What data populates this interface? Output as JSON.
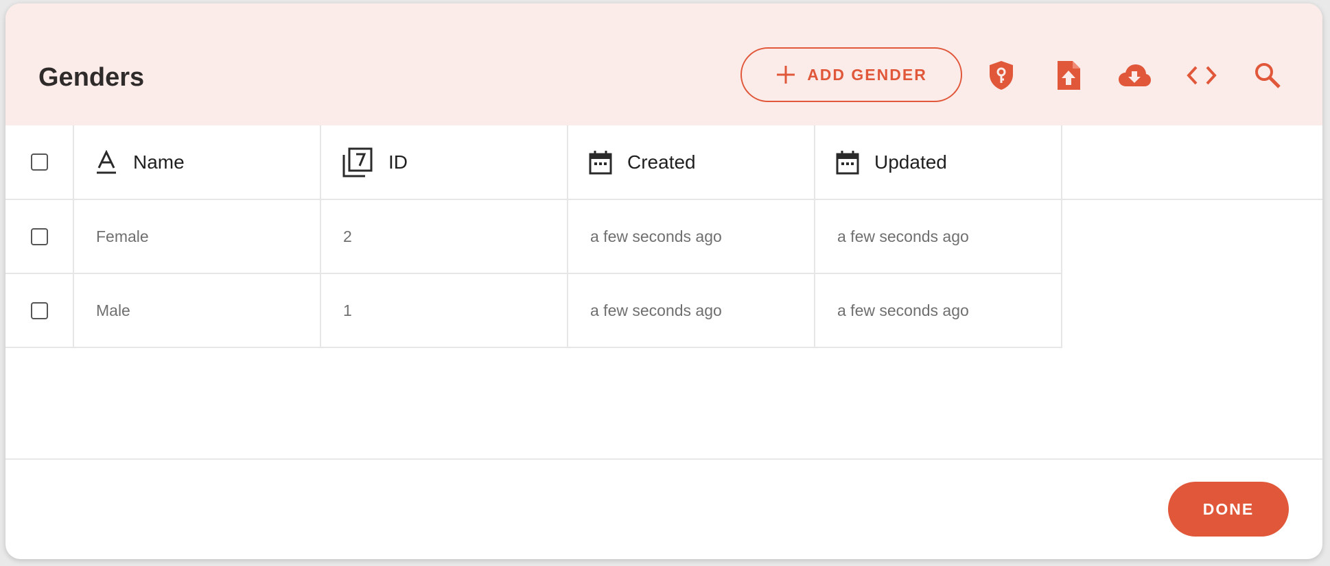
{
  "dialog": {
    "title": "Genders",
    "add_button_label": "ADD GENDER",
    "toolbar_icons": [
      "shield-key-icon",
      "file-upload-icon",
      "cloud-download-icon",
      "code-icon",
      "search-icon"
    ],
    "done_label": "DONE",
    "accent_color": "#e0573a",
    "header_bg": "#fcece9"
  },
  "table": {
    "columns": [
      {
        "label": "Name",
        "icon": "text-format-icon"
      },
      {
        "label": "ID",
        "icon": "number-box-icon"
      },
      {
        "label": "Created",
        "icon": "calendar-icon"
      },
      {
        "label": "Updated",
        "icon": "calendar-icon"
      }
    ],
    "rows": [
      {
        "name": "Female",
        "id": "2",
        "created": "a few seconds ago",
        "updated": "a few seconds ago"
      },
      {
        "name": "Male",
        "id": "1",
        "created": "a few seconds ago",
        "updated": "a few seconds ago"
      }
    ]
  }
}
